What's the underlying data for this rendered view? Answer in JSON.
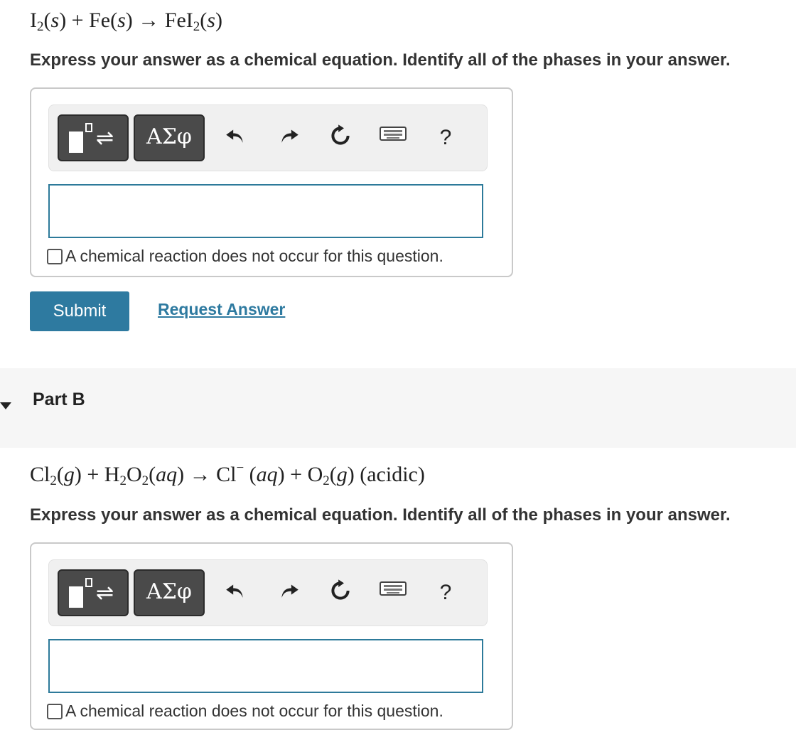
{
  "part_a": {
    "equation": {
      "t1": "I",
      "s1": "2",
      "t2": "(",
      "ph1": "s",
      "t3": ") + Fe(",
      "ph2": "s",
      "t4": ") → FeI",
      "s2": "2",
      "t5": "(",
      "ph3": "s",
      "t6": ")"
    },
    "instruction": "Express your answer as a chemical equation. Identify all of the phases in your answer.",
    "no_reaction_label": "A chemical reaction does not occur for this question.",
    "submit_label": "Submit",
    "request_answer_label": "Request Answer"
  },
  "part_b_header": {
    "label": "Part B"
  },
  "part_b": {
    "equation": {
      "t1": "Cl",
      "s1": "2",
      "t2": "(",
      "ph1": "g",
      "t3": ") + H",
      "s2": "2",
      "t4": "O",
      "s3": "2",
      "t5": "(",
      "ph2": "aq",
      "t6": ") → Cl",
      "sup1": "−",
      "t7": " (",
      "ph3": "aq",
      "t8": ") + O",
      "s4": "2",
      "t9": "(",
      "ph4": "g",
      "t10": ") (acidic)"
    },
    "instruction": "Express your answer as a chemical equation. Identify all of the phases in your answer.",
    "no_reaction_label": "A chemical reaction does not occur for this question."
  },
  "toolbar": {
    "symbols_label": "ΑΣφ",
    "help_label": "?",
    "icons": [
      "templates-icon",
      "undo-icon",
      "redo-icon",
      "reset-icon",
      "keyboard-icon",
      "help-icon"
    ]
  },
  "colors": {
    "accent": "#2e7aa0",
    "toolbar_button": "#4a4a4a",
    "part_bar": "#f6f6f6"
  }
}
